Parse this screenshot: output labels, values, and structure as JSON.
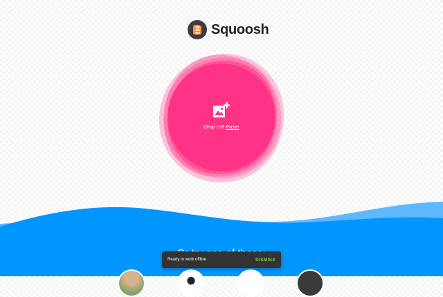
{
  "app": {
    "name": "Squoosh"
  },
  "dropzone": {
    "prompt_prefix": "Drop OR ",
    "paste_label": "Paste",
    "icon": "add-image-icon",
    "color": "#ff3385"
  },
  "demos": {
    "title": "Or try one of these:"
  },
  "toast": {
    "message": "Ready to work offline",
    "action_label": "DISMISS"
  },
  "colors": {
    "wave_front": "#0096ff",
    "wave_back": "#5fb8ff",
    "toast_action": "#8bc34a"
  }
}
